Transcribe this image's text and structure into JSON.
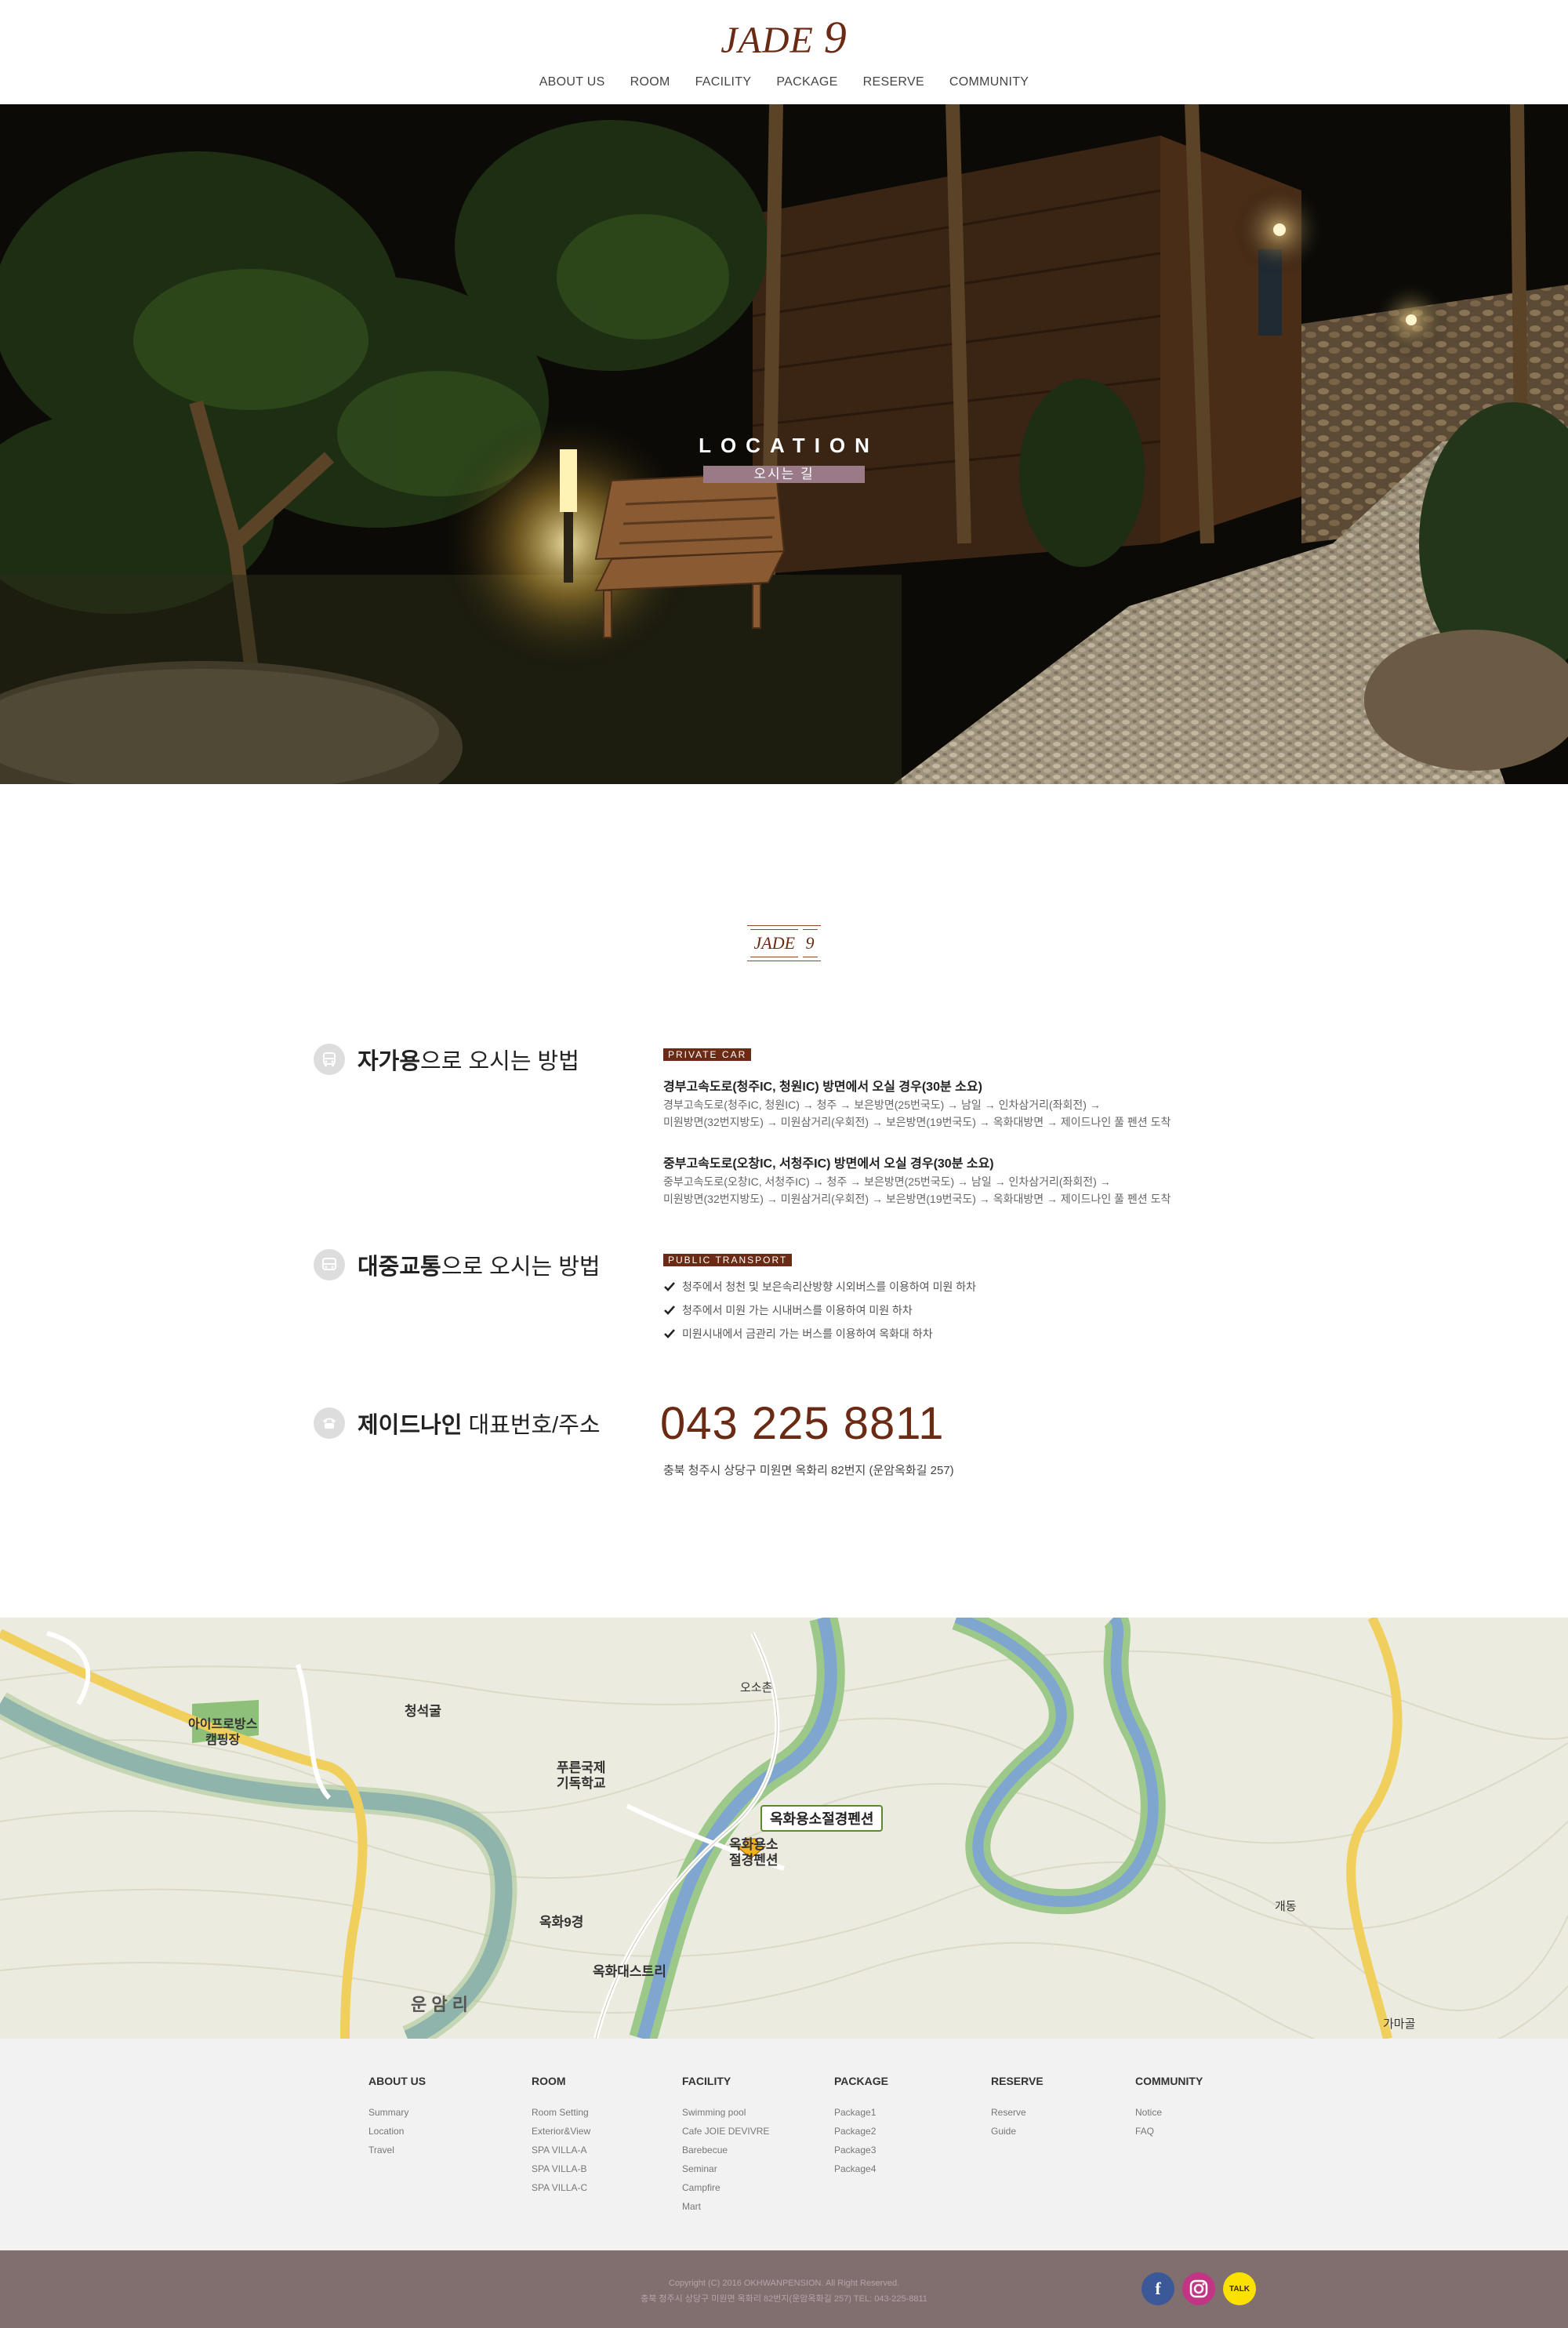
{
  "header": {
    "logo_text": "JADE",
    "logo_num": "9",
    "nav": [
      "ABOUT US",
      "ROOM",
      "FACILITY",
      "PACKAGE",
      "RESERVE",
      "COMMUNITY"
    ]
  },
  "hero": {
    "title_en": "LOCATION",
    "title_ko": "오시는 길"
  },
  "section_logo": {
    "text": "JADE",
    "num": "9"
  },
  "private_car": {
    "title_bold": "자가용",
    "title_rest": "으로 오시는 방법",
    "tag": "PRIVATE CAR",
    "route1_heading": "경부고속도로(청주IC, 청원IC) 방면에서 오실 경우(30분 소요)",
    "route1_line1": "경부고속도로(청주IC, 청원IC) → 청주 → 보은방면(25번국도) → 남일 → 인차삼거리(좌회전) →",
    "route1_line2": "미원방면(32번지방도) → 미원삼거리(우회전) → 보은방면(19번국도) → 옥화대방면 → 제이드나인 풀 펜션 도착",
    "route2_heading": "중부고속도로(오창IC, 서청주IC) 방면에서 오실 경우(30분 소요)",
    "route2_line1": "중부고속도로(오창IC, 서청주IC) → 청주 → 보은방면(25번국도) → 남일 → 인차삼거리(좌회전) →",
    "route2_line2": "미원방면(32번지방도) → 미원삼거리(우회전) → 보은방면(19번국도) → 옥화대방면 → 제이드나인 풀 펜션 도착"
  },
  "public_transport": {
    "title_bold": "대중교통",
    "title_rest": "으로 오시는 방법",
    "tag": "PUBLIC TRANSPORT",
    "items": [
      "청주에서 청천 및 보은속리산방향 시외버스를 이용하여 미원 하차",
      "청주에서 미원 가는 시내버스를 이용하여 미원 하차",
      "미원시내에서 금관리 가는 버스를 이용하여 옥화대 하차"
    ]
  },
  "contact": {
    "title_bold": "제이드나인",
    "title_rest": " 대표번호/주소",
    "phone": "043 225 8811",
    "address": "충북 청주시 상당구 미원면 옥화리 82번지 (운암옥화길 257)"
  },
  "map": {
    "labels": {
      "camp": "아이프로방스\n캠핑장",
      "cheongseokgul": "청석굴",
      "school": "푸른국제\n기독학교",
      "osochon": "오소촌",
      "pin_label": "옥화용소절경펜션",
      "pension": "옥화용소\n절경펜션",
      "okhwa9": "옥화9경",
      "destri": "옥화대스트리",
      "unamri": "운 암 리",
      "gaedong": "개동",
      "gamagol": "가마골"
    }
  },
  "footer": {
    "columns": [
      {
        "title": "ABOUT US",
        "items": [
          "Summary",
          "Location",
          "Travel"
        ]
      },
      {
        "title": "ROOM",
        "items": [
          "Room Setting",
          "Exterior&View",
          "SPA VILLA-A",
          "SPA VILLA-B",
          "SPA VILLA-C"
        ]
      },
      {
        "title": "FACILITY",
        "items": [
          "Swimming pool",
          "Cafe JOIE DEVIVRE",
          "Barebecue",
          "Seminar",
          "Campfire",
          "Mart"
        ]
      },
      {
        "title": "PACKAGE",
        "items": [
          "Package1",
          "Package2",
          "Package3",
          "Package4"
        ]
      },
      {
        "title": "RESERVE",
        "items": [
          "Reserve",
          "Guide"
        ]
      },
      {
        "title": "COMMUNITY",
        "items": [
          "Notice",
          "FAQ"
        ]
      }
    ],
    "copyright": "Copyright (C) 2016 OKHWANPENSION. All Right Reserved.",
    "address_line": "충북 청주시 상당구 미원면 옥화리 82번지(운암옥화길 257) TEL: 043-225-8811",
    "social": {
      "facebook": "f",
      "instagram": "instagram-icon",
      "kakao": "TALK"
    }
  },
  "colors": {
    "brand": "#6b2a14",
    "tag_bg": "#6b2a14",
    "hero_badge": "#9a7a86",
    "bottom_bar": "#816e6f"
  }
}
